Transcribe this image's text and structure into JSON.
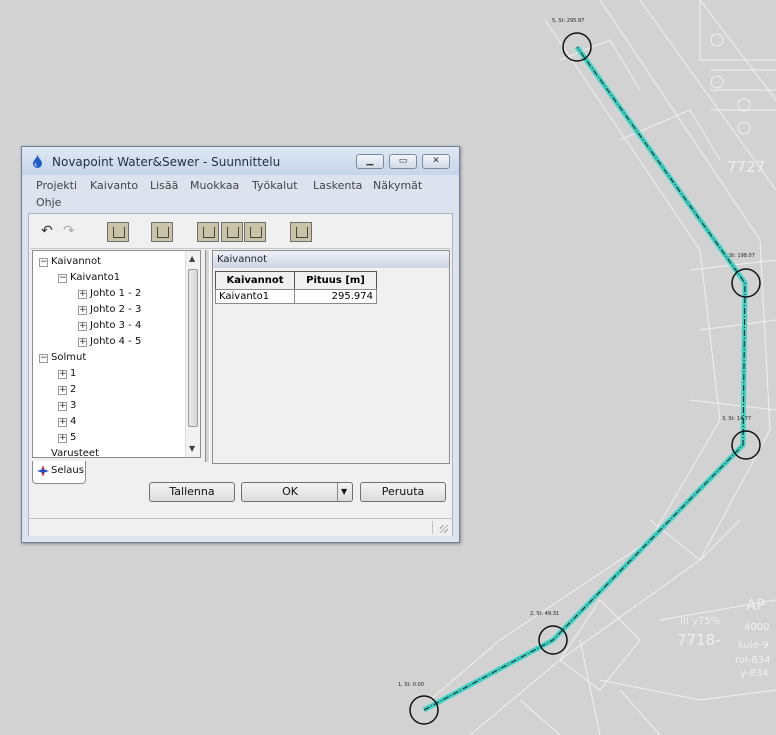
{
  "window": {
    "title": "Novapoint Water&Sewer - Suunnittelu"
  },
  "menu": [
    "Projekti",
    "Kaivanto",
    "Lisää",
    "Muokkaa",
    "Työkalut",
    "Laskenta",
    "Näkymät",
    "Ohje"
  ],
  "tree": {
    "root": "Kaivannot",
    "kaivanto": "Kaivanto1",
    "johdot": [
      "Johto 1 - 2",
      "Johto 2 - 3",
      "Johto 3 - 4",
      "Johto 4 - 5"
    ],
    "solmut_label": "Solmut",
    "solmut": [
      "1",
      "2",
      "3",
      "4",
      "5"
    ],
    "varusteet": "Varusteet"
  },
  "tab": {
    "label": "Selaus"
  },
  "panel": {
    "title": "Kaivannot",
    "columns": [
      "Kaivannot",
      "Pituus [m]"
    ],
    "rows": [
      [
        "Kaivanto1",
        "295.974"
      ]
    ]
  },
  "buttons": {
    "save": "Tallenna",
    "ok": "OK",
    "cancel": "Peruuta"
  },
  "drawing": {
    "station_labels": [
      "1, St: 0.00",
      "2, St: 49.31",
      "3, St: 14.77",
      "St: 198.07",
      "5, St: 295.97"
    ],
    "background_texts": [
      "7727",
      "7718-",
      "AP",
      "III y75%",
      "kule-9",
      "rol-834",
      "y-834",
      "4000"
    ],
    "colors": {
      "pipe": "#3fd3c6",
      "centerline": "#1a1a1a",
      "background": "#d2d2d2",
      "linework": "#f0f0f0"
    }
  }
}
